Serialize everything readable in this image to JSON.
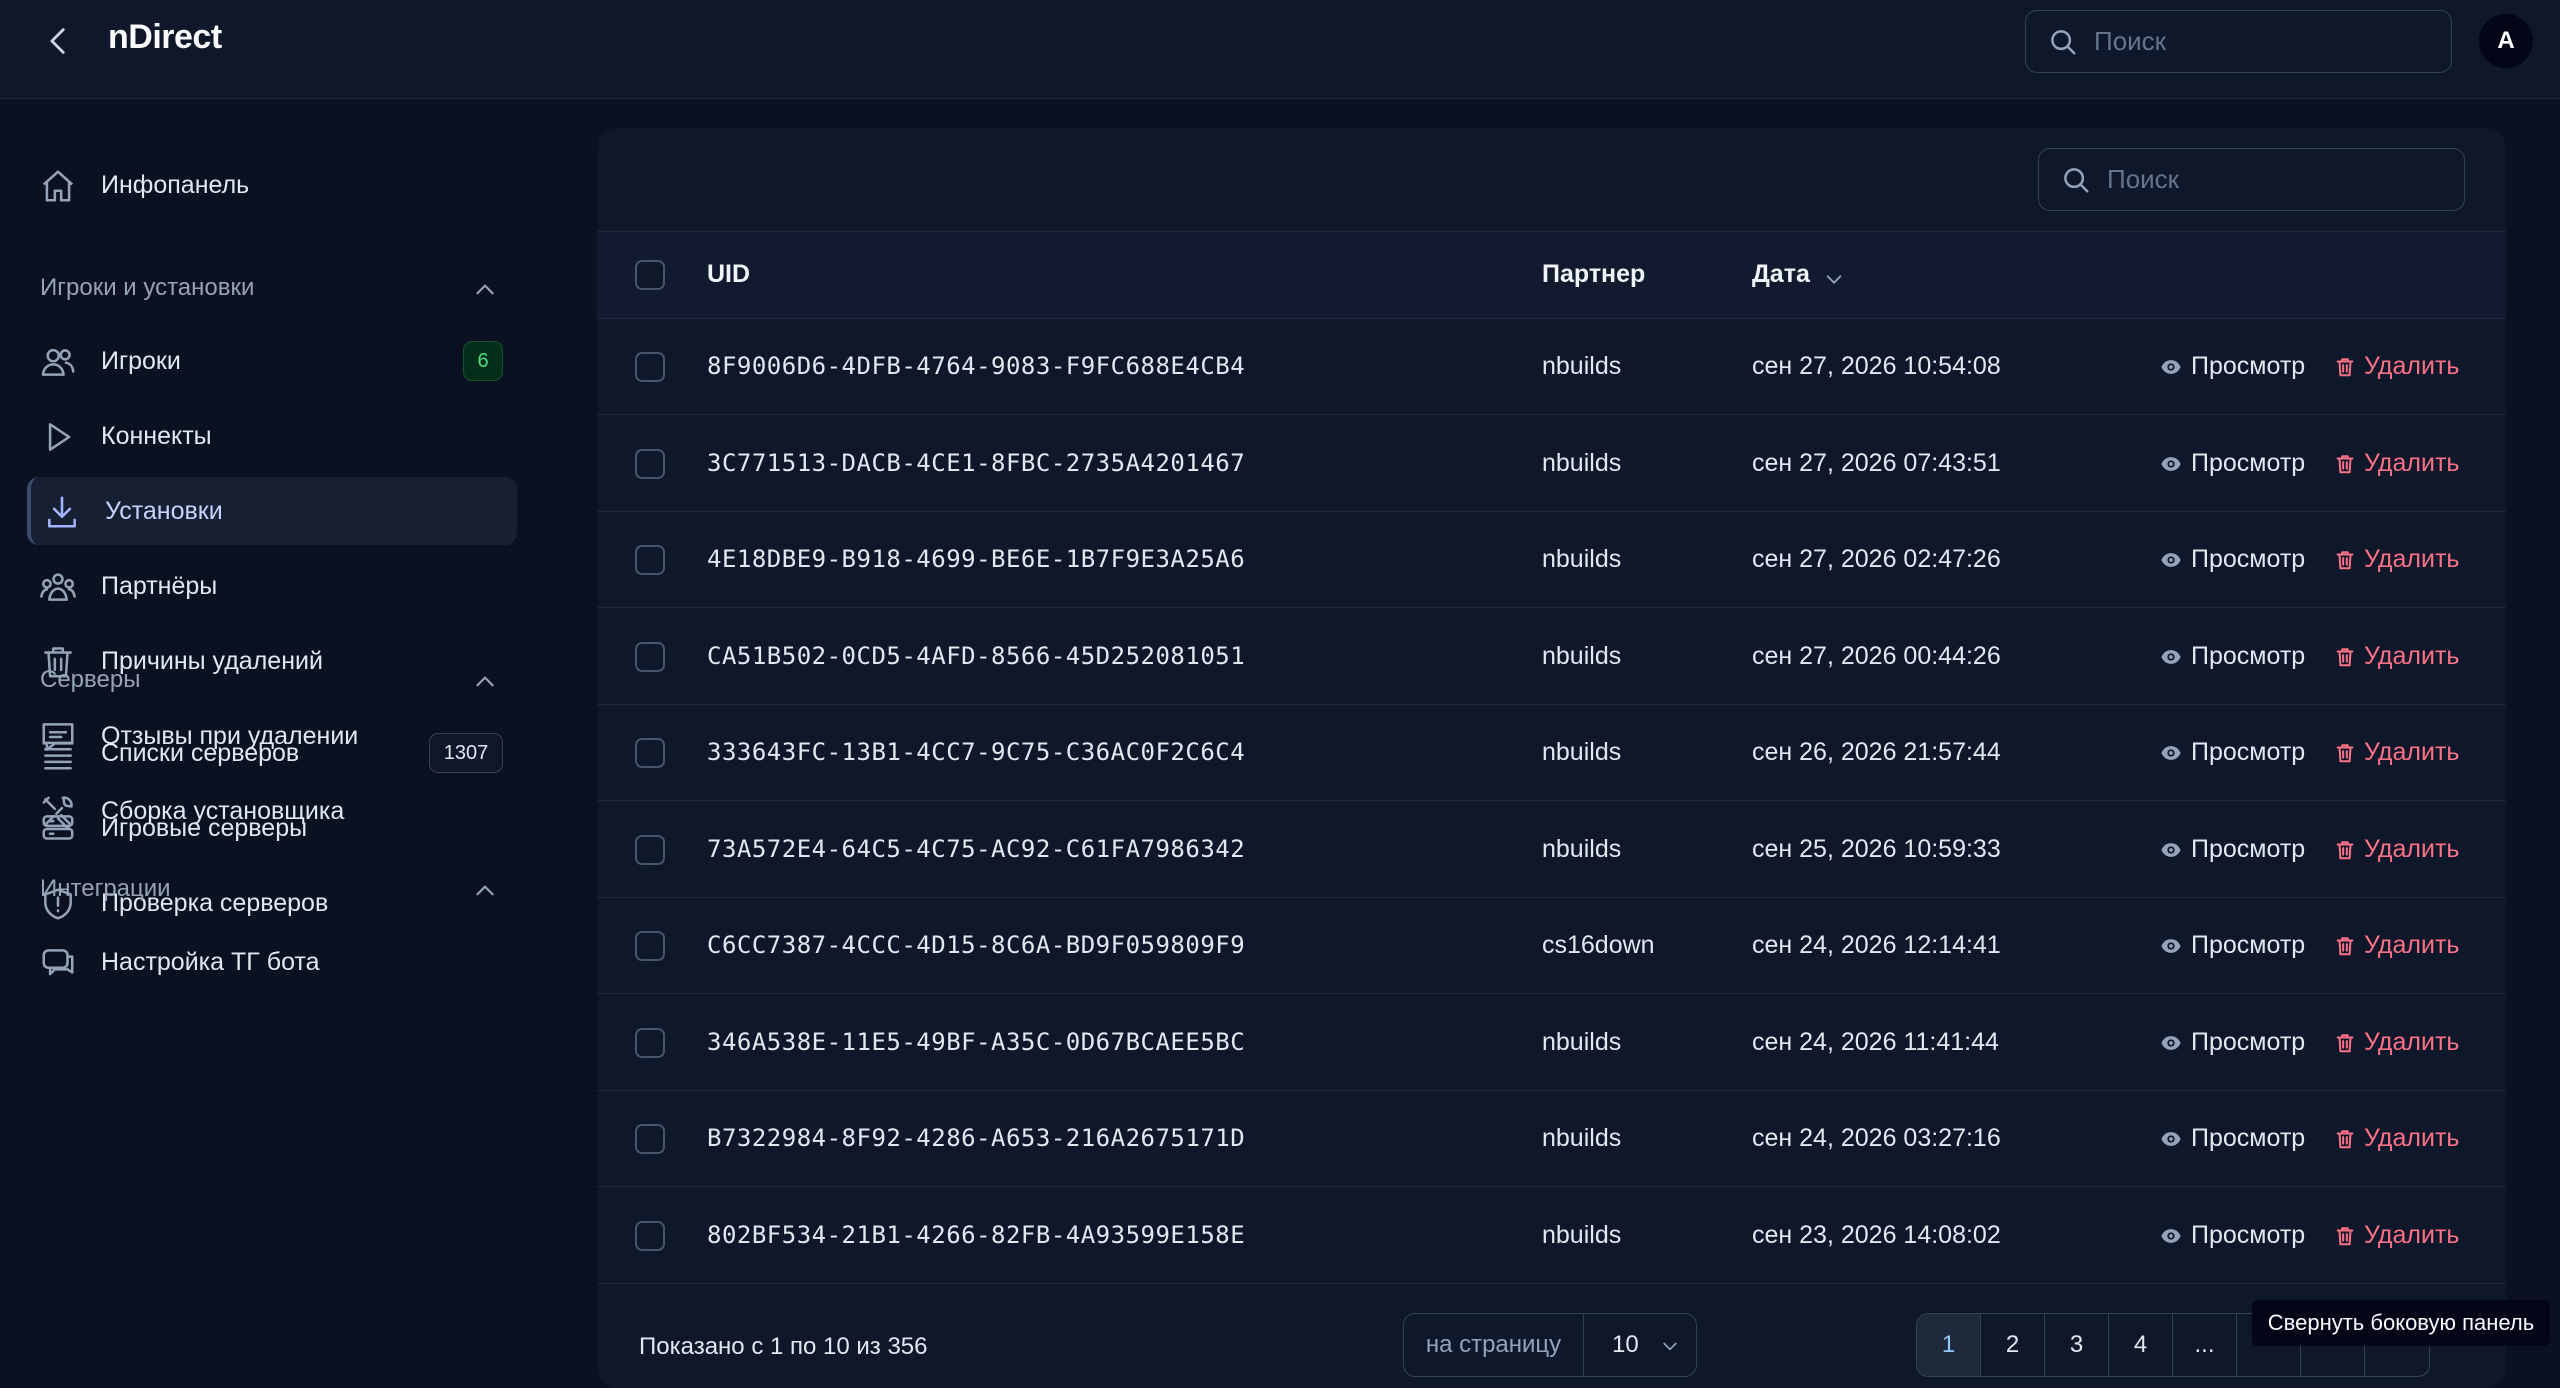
{
  "app": {
    "title": "nDirect"
  },
  "header": {
    "search_placeholder": "Поиск",
    "avatar_initial": "A"
  },
  "sidebar": {
    "dashboard_label": "Инфопанель",
    "sections": [
      {
        "title": "Игроки и установки",
        "items": [
          {
            "label": "Игроки",
            "icon": "users-icon",
            "badge": "6"
          },
          {
            "label": "Коннекты",
            "icon": "play-icon"
          },
          {
            "label": "Установки",
            "icon": "download-icon",
            "active": true
          },
          {
            "label": "Партнёры",
            "icon": "partners-icon"
          },
          {
            "label": "Причины удалений",
            "icon": "trash-icon"
          },
          {
            "label": "Отзывы при удалении",
            "icon": "comment-icon"
          },
          {
            "label": "Сборка установщика",
            "icon": "tools-icon"
          }
        ]
      },
      {
        "title": "Серверы",
        "items": [
          {
            "label": "Списки серверов",
            "icon": "list-icon",
            "badge": "1307"
          },
          {
            "label": "Игровые серверы",
            "icon": "server-icon"
          },
          {
            "label": "Проверка серверов",
            "icon": "shield-icon"
          }
        ]
      },
      {
        "title": "Интеграции",
        "items": [
          {
            "label": "Настройка ТГ бота",
            "icon": "chat-icon"
          }
        ]
      }
    ]
  },
  "table": {
    "search_placeholder": "Поиск",
    "columns": {
      "uid": "UID",
      "partner": "Партнер",
      "date": "Дата"
    },
    "view_label": "Просмотр",
    "delete_label": "Удалить",
    "rows": [
      {
        "uid": "8F9006D6-4DFB-4764-9083-F9FC688E4CB4",
        "partner": "nbuilds",
        "date": "сен 27, 2026 10:54:08"
      },
      {
        "uid": "3C771513-DACB-4CE1-8FBC-2735A4201467",
        "partner": "nbuilds",
        "date": "сен 27, 2026 07:43:51"
      },
      {
        "uid": "4E18DBE9-B918-4699-BE6E-1B7F9E3A25A6",
        "partner": "nbuilds",
        "date": "сен 27, 2026 02:47:26"
      },
      {
        "uid": "CA51B502-0CD5-4AFD-8566-45D252081051",
        "partner": "nbuilds",
        "date": "сен 27, 2026 00:44:26"
      },
      {
        "uid": "333643FC-13B1-4CC7-9C75-C36AC0F2C6C4",
        "partner": "nbuilds",
        "date": "сен 26, 2026 21:57:44"
      },
      {
        "uid": "73A572E4-64C5-4C75-AC92-C61FA7986342",
        "partner": "nbuilds",
        "date": "сен 25, 2026 10:59:33"
      },
      {
        "uid": "C6CC7387-4CCC-4D15-8C6A-BD9F059809F9",
        "partner": "cs16down",
        "date": "сен 24, 2026 12:14:41"
      },
      {
        "uid": "346A538E-11E5-49BF-A35C-0D67BCAEE5BC",
        "partner": "nbuilds",
        "date": "сен 24, 2026 11:41:44"
      },
      {
        "uid": "B7322984-8F92-4286-A653-216A2675171D",
        "partner": "nbuilds",
        "date": "сен 24, 2026 03:27:16"
      },
      {
        "uid": "802BF534-21B1-4266-82FB-4A93599E158E",
        "partner": "nbuilds",
        "date": "сен 23, 2026 14:08:02"
      }
    ]
  },
  "footer": {
    "shown_text": "Показано с 1 по 10 из 356",
    "per_page_label": "на страницу",
    "per_page_value": "10",
    "pages": [
      "1",
      "2",
      "3",
      "4",
      "...",
      "",
      "",
      ""
    ],
    "current_page": "1"
  },
  "tooltip": "Свернуть боковую панель",
  "colors": {
    "background": "#0b1120",
    "panel": "#0f172a",
    "accent": "#93c5fd",
    "danger": "#fb7185",
    "badge_green": "#4ade80"
  }
}
